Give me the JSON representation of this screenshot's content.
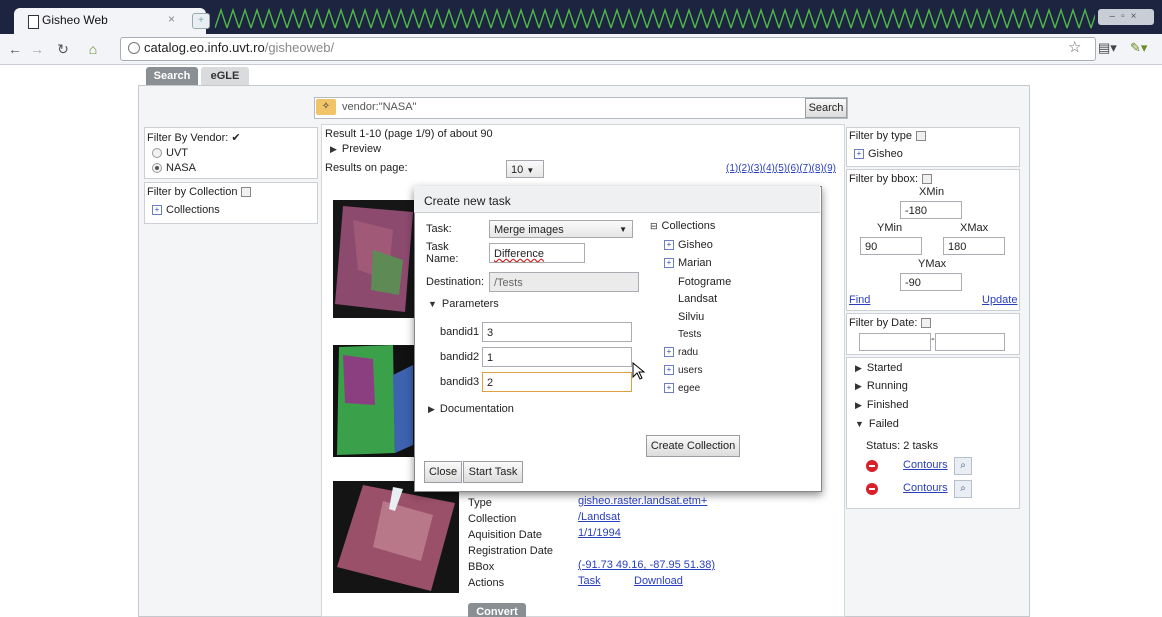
{
  "browser": {
    "tab_title": "Gisheo Web",
    "url_host": "catalog.eo.info.uvt.ro",
    "url_path": "/gisheoweb/"
  },
  "app_tabs": [
    "Search",
    "eGLE"
  ],
  "search": {
    "query": "vendor:\"NASA\"",
    "button": "Search"
  },
  "vendor_filter": {
    "title": "Filter By Vendor:",
    "options": [
      "UVT",
      "NASA"
    ],
    "selected": "NASA"
  },
  "collection_filter": {
    "title": "Filter by Collection",
    "root": "Collections"
  },
  "results": {
    "summary": "Result 1-10 (page 1/9) of about 90",
    "preview": "Preview",
    "per_page_label": "Results on page:",
    "per_page_value": "10",
    "pagination": "(1)(2)(3)(4)(5)(6)(7)(8)(9)"
  },
  "result_details": {
    "labels": [
      "Type",
      "Collection",
      "Aquisition Date",
      "Registration Date",
      "BBox",
      "Actions"
    ],
    "type": "gisheo.raster.landsat.etm+",
    "collection": "/Landsat",
    "aquisition_date": "1/1/1994",
    "bbox": "(-91.73 49.16, -87.95 51.38)",
    "action_task": "Task",
    "action_download": "Download",
    "bottom_button": "Convert"
  },
  "dialog": {
    "title": "Create new task",
    "task_label": "Task:",
    "task_value": "Merge images",
    "task_name_label_1": "Task",
    "task_name_label_2": "Name:",
    "task_name_value": "Difference",
    "destination_label": "Destination:",
    "destination_value": "/Tests",
    "parameters_label": "Parameters",
    "params": [
      {
        "label": "bandid1",
        "value": "3"
      },
      {
        "label": "bandid2",
        "value": "1"
      },
      {
        "label": "bandid3",
        "value": "2"
      }
    ],
    "documentation_label": "Documentation",
    "tree_root": "Collections",
    "tree_items": [
      "Gisheo",
      "Marian",
      "Fotograme",
      "Landsat",
      "Silviu",
      "Tests",
      "radu",
      "users",
      "egee"
    ],
    "create_collection": "Create Collection",
    "close": "Close",
    "start_task": "Start Task"
  },
  "type_filter": {
    "title": "Filter by type",
    "item": "Gisheo"
  },
  "bbox_filter": {
    "title": "Filter by bbox:",
    "xmin_label": "XMin",
    "xmin": "-180",
    "ymin_label": "YMin",
    "ymin": "90",
    "xmax_label": "XMax",
    "xmax": "180",
    "ymax_label": "YMax",
    "ymax": "-90",
    "find": "Find",
    "update": "Update"
  },
  "date_filter": {
    "title": "Filter by Date:",
    "separator": "-"
  },
  "status": {
    "groups": [
      "Started",
      "Running",
      "Finished",
      "Failed"
    ],
    "summary": "Status: 2 tasks",
    "tasks": [
      "Contours",
      "Contours"
    ]
  },
  "colors": {
    "accent_link": "#2a3fbd",
    "error": "#d8202a",
    "tab_active": "#8a8f94"
  }
}
